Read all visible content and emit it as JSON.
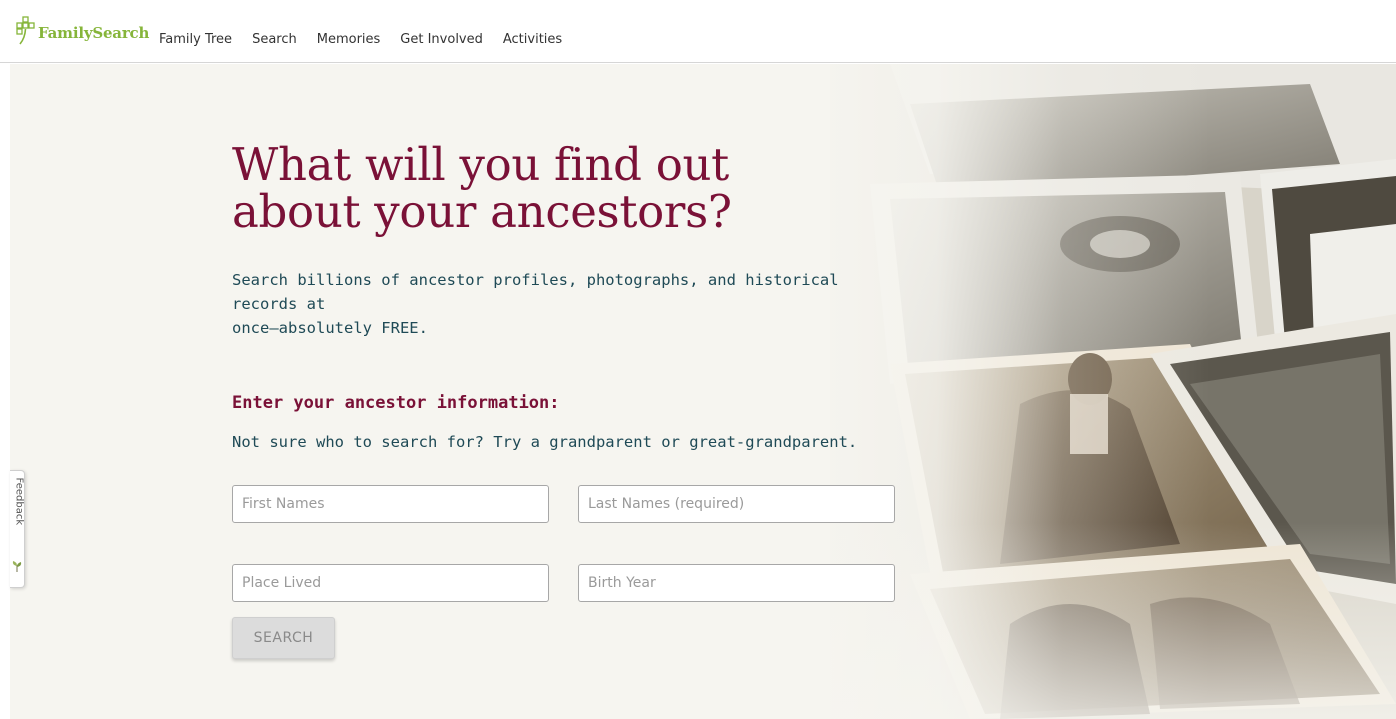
{
  "brand": {
    "name": "FamilySearch",
    "logo_icon": "family-tree-logo-icon",
    "color": "#86b53a"
  },
  "nav": {
    "items": [
      {
        "label": "Family Tree"
      },
      {
        "label": "Search"
      },
      {
        "label": "Memories"
      },
      {
        "label": "Get Involved"
      },
      {
        "label": "Activities"
      }
    ]
  },
  "hero": {
    "headline_line1": "What will you find out",
    "headline_line2": "about your ancestors?",
    "subhead_line1": "Search billions of ancestor profiles, photographs, and historical records at",
    "subhead_line2": "once—absolutely FREE.",
    "headline_color": "#7a1137",
    "body_color": "#1f4a56"
  },
  "form": {
    "title": "Enter your ancestor information:",
    "hint": "Not sure who to search for? Try a grandparent or great-grandparent.",
    "first_names_placeholder": "First Names",
    "last_names_placeholder": "Last Names (required)",
    "place_lived_placeholder": "Place Lived",
    "birth_year_placeholder": "Birth Year",
    "first_names_value": "",
    "last_names_value": "",
    "place_lived_value": "",
    "birth_year_value": "",
    "search_label": "SEARCH"
  },
  "feedback": {
    "label": "Feedback",
    "icon": "feedback-sprout-icon"
  }
}
